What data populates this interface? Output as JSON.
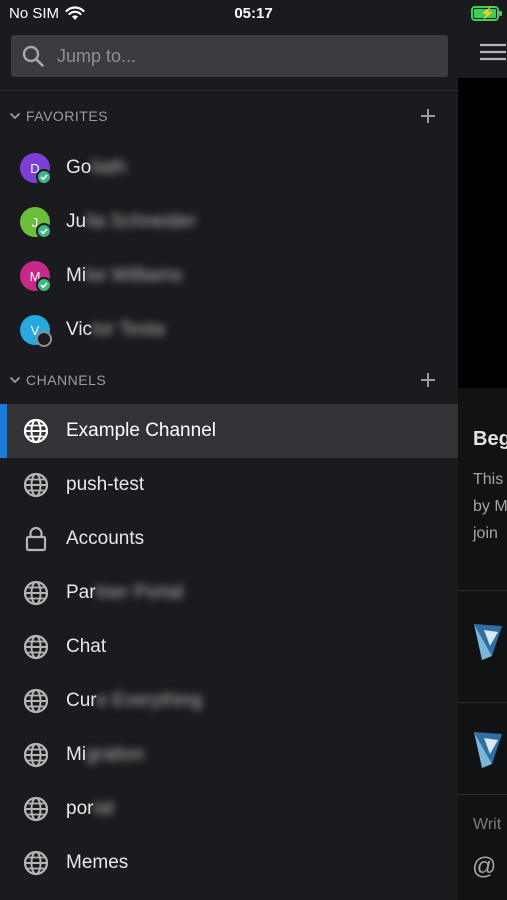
{
  "status_bar": {
    "carrier": "No SIM",
    "time": "05:17"
  },
  "search": {
    "placeholder": "Jump to..."
  },
  "favorites": {
    "title": "FAVORITES",
    "items": [
      {
        "initial": "D",
        "visible": "Go",
        "hidden": "liath",
        "avatar_color": "#7b3fd4",
        "status": "online"
      },
      {
        "initial": "J",
        "visible": "Ju",
        "hidden": "lia Schneider",
        "avatar_color": "#6bbf3a",
        "status": "online"
      },
      {
        "initial": "M",
        "visible": "Mi",
        "hidden": "ke Williams",
        "avatar_color": "#c8288a",
        "status": "online"
      },
      {
        "initial": "V",
        "visible": "Vic",
        "hidden": "tor Testa",
        "avatar_color": "#29a8e0",
        "status": "offline"
      }
    ]
  },
  "channels": {
    "title": "CHANNELS",
    "items": [
      {
        "visible": "Example Channel",
        "hidden": "",
        "icon": "globe-icon",
        "active": true
      },
      {
        "visible": "push-test",
        "hidden": "",
        "icon": "globe-icon"
      },
      {
        "visible": "Accounts",
        "hidden": "",
        "icon": "lock-icon"
      },
      {
        "visible": "Par",
        "hidden": "tner Portal",
        "icon": "globe-icon"
      },
      {
        "visible": "Chat",
        "hidden": "",
        "icon": "globe-icon"
      },
      {
        "visible": "Cur",
        "hidden": "e Everything",
        "icon": "globe-icon"
      },
      {
        "visible": "Mi",
        "hidden": "gration",
        "icon": "globe-icon"
      },
      {
        "visible": "por",
        "hidden": "tal",
        "icon": "globe-icon"
      },
      {
        "visible": "Memes",
        "hidden": "",
        "icon": "globe-icon"
      }
    ]
  },
  "peek": {
    "title": "Beg",
    "lines": [
      "This",
      "by M",
      "join"
    ],
    "write": "Writ",
    "at": "@"
  },
  "colors": {
    "accent": "#1c7bd9",
    "sidebar_bg": "#1a1b1e",
    "active_bg": "#323336",
    "online": "#3db887"
  }
}
